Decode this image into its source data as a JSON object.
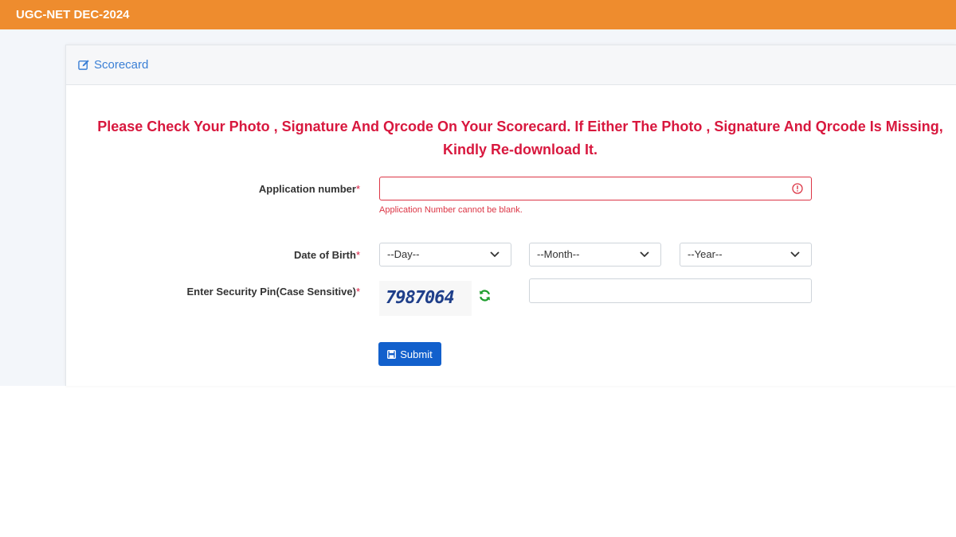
{
  "header": {
    "title": "UGC-NET DEC-2024"
  },
  "card": {
    "title": "Scorecard",
    "icon": "edit-icon"
  },
  "notice": {
    "line1": "Please Check Your Photo , Signature And Qrcode On Your Scorecard. If Either The Photo , Signature And Qrcode Is Missing,",
    "line2": "Kindly Re-download It."
  },
  "form": {
    "application_number": {
      "label": "Application number",
      "required_mark": "*",
      "value": "",
      "error": "Application Number cannot be blank."
    },
    "dob": {
      "label": "Date of Birth",
      "required_mark": "*",
      "day": "--Day--",
      "month": "--Month--",
      "year": "--Year--"
    },
    "security_pin": {
      "label": "Enter Security Pin(Case Sensitive)",
      "required_mark": "*",
      "captcha": "7987064",
      "value": ""
    },
    "submit_label": "Submit"
  },
  "colors": {
    "header_bg": "#ee8c2e",
    "notice": "#d8183e",
    "accent": "#3a7fd5",
    "submit_bg": "#1260cc",
    "refresh_icon": "#1e9e2e"
  }
}
